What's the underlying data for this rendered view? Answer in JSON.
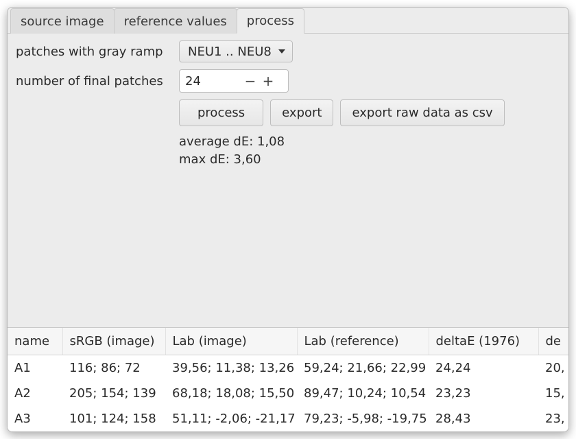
{
  "tabs": [
    {
      "label": "source image",
      "active": false
    },
    {
      "label": "reference values",
      "active": false
    },
    {
      "label": "process",
      "active": true
    }
  ],
  "form": {
    "gray_ramp_label": "patches with gray ramp",
    "gray_ramp_value": "NEU1 .. NEU8",
    "num_patches_label": "number of final patches",
    "num_patches_value": "24"
  },
  "buttons": {
    "process": "process",
    "export": "export",
    "export_csv": "export raw data as csv"
  },
  "stats": {
    "avg": "average dE: 1,08",
    "max": "max dE: 3,60"
  },
  "table": {
    "headers": [
      "name",
      "sRGB (image)",
      "Lab (image)",
      "Lab (reference)",
      "deltaE (1976)",
      "de"
    ],
    "rows": [
      {
        "name": "A1",
        "srgb": "116; 86; 72",
        "lab_img": "39,56; 11,38; 13,26",
        "lab_ref": "59,24; 21,66; 22,99",
        "de76": "24,24",
        "de_extra": "20,"
      },
      {
        "name": "A2",
        "srgb": "205; 154; 139",
        "lab_img": "68,18; 18,08; 15,50",
        "lab_ref": "89,47; 10,24; 10,54",
        "de76": "23,23",
        "de_extra": "15,"
      },
      {
        "name": "A3",
        "srgb": "101; 124; 158",
        "lab_img": "51,11; -2,06; -21,17",
        "lab_ref": "79,23; -5,98; -19,75",
        "de76": "28,43",
        "de_extra": "23,"
      }
    ]
  }
}
